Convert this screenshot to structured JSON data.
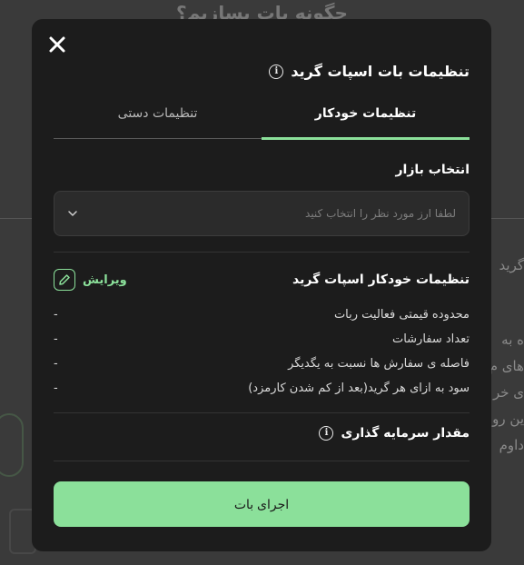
{
  "background": {
    "title": "چگونه بات بسازیم؟",
    "side_lines_1": [
      "گرید"
    ],
    "side_lines_2": [
      "ه به",
      "های م",
      "ی خر",
      "ین رو",
      "داوم"
    ]
  },
  "modal": {
    "title": "تنظیمات بات اسپات گرید",
    "tabs": [
      {
        "label": "تنظیمات خودکار",
        "active": true
      },
      {
        "label": "تنظیمات دستی",
        "active": false
      }
    ],
    "market": {
      "label": "انتخاب بازار",
      "placeholder": "لطفا ارز مورد نظر را انتخاب کنید"
    },
    "auto_settings": {
      "title": "تنظیمات خودکار اسپات گرید",
      "edit_label": "ویرایش",
      "rows": [
        {
          "label": "محدوده قیمتی فعالیت ربات",
          "value": "-"
        },
        {
          "label": "تعداد سفارشات",
          "value": "-"
        },
        {
          "label": "فاصله ی سفارش ها نسبت به یگدیگر",
          "value": "-"
        },
        {
          "label": "سود به ازای هر گرید(بعد از کم شدن کارمزد)",
          "value": "-"
        }
      ]
    },
    "investment_label": "مقدار سرمایه گذاری",
    "run_button": "اجرای بات"
  },
  "colors": {
    "accent": "#8be09a",
    "modal_bg": "#1c1c1c",
    "input_bg": "#2b2b2b"
  }
}
